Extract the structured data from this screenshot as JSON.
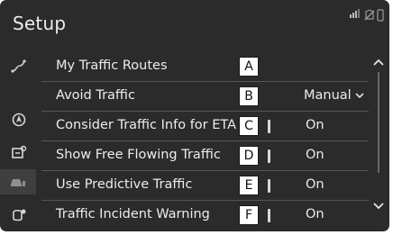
{
  "header": {
    "title": "Setup"
  },
  "sidebar": {
    "icons": [
      "route-icon",
      "navigation-icon",
      "map-setting-icon",
      "traffic-icon",
      "settings-icon"
    ]
  },
  "rows": [
    {
      "label": "My Traffic Routes",
      "callout": "A",
      "value": ""
    },
    {
      "label": "Avoid Traffic",
      "callout": "B",
      "value": "Manual"
    },
    {
      "label": "Consider Traffic Info for ETA",
      "callout": "C",
      "value": "On"
    },
    {
      "label": "Show Free Flowing Traffic",
      "callout": "D",
      "value": "On"
    },
    {
      "label": "Use Predictive Traffic",
      "callout": "E",
      "value": "On"
    },
    {
      "label": "Traffic Incident Warning",
      "callout": "F",
      "value": "On"
    }
  ],
  "colors": {
    "background": "#2b2b2b",
    "text": "#ececec",
    "divider": "#555555"
  }
}
